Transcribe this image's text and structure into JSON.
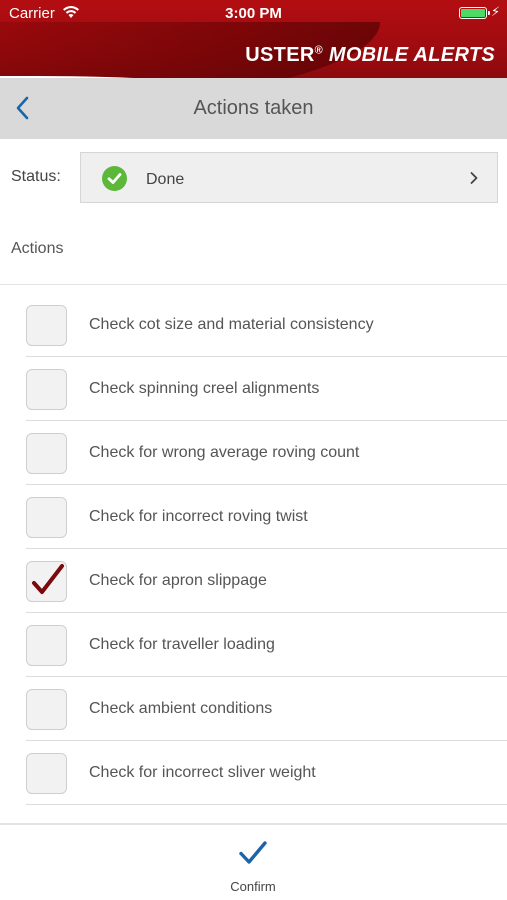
{
  "status_bar": {
    "carrier": "Carrier",
    "time": "3:00 PM"
  },
  "brand": {
    "name": "USTER",
    "mark": "®",
    "tagline": "MOBILE ALERTS"
  },
  "nav": {
    "title": "Actions taken",
    "back_icon": "chevron-left-icon"
  },
  "status": {
    "label": "Status:",
    "value": "Done",
    "icon": "check-circle-icon"
  },
  "actions": {
    "heading": "Actions",
    "items": [
      {
        "label": "Check cot size and material consistency",
        "checked": false
      },
      {
        "label": "Check spinning creel alignments",
        "checked": false
      },
      {
        "label": "Check for wrong average roving count",
        "checked": false
      },
      {
        "label": "Check for incorrect roving twist",
        "checked": false
      },
      {
        "label": "Check for apron slippage",
        "checked": true
      },
      {
        "label": "Check for traveller loading",
        "checked": false
      },
      {
        "label": "Check ambient conditions",
        "checked": false
      },
      {
        "label": "Check for incorrect sliver weight",
        "checked": false
      }
    ]
  },
  "toolbar": {
    "confirm_label": "Confirm"
  },
  "colors": {
    "brand_red": "#a50d11",
    "accent_blue": "#1c64a8",
    "check_green": "#5cb83a",
    "checkmark_red": "#7a0a0d"
  }
}
